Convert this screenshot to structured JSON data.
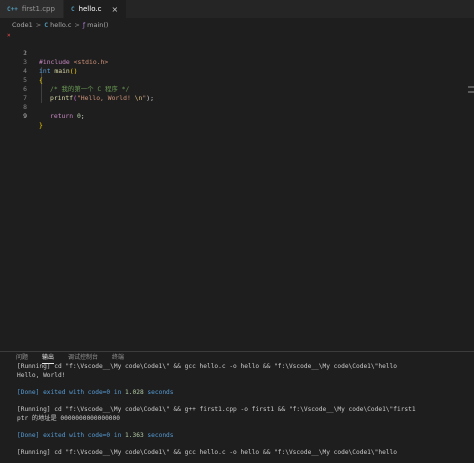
{
  "tabs": [
    {
      "lang": "C++",
      "label": "first1.cpp",
      "active": false
    },
    {
      "lang": "C",
      "label": "hello.c",
      "active": true,
      "close": "×"
    }
  ],
  "breadcrumb": {
    "folder": "Code1",
    "sep1": ">",
    "file_lang": "C",
    "file": "hello.c",
    "sep2": ">",
    "func_icon": "ƒ",
    "func": "main()"
  },
  "editor": {
    "line_numbers": [
      "1",
      "2",
      "3",
      "4",
      "5",
      "6",
      "7",
      "8",
      "9"
    ],
    "error_marker": "×",
    "lines": {
      "l1_inc": "#include",
      "l1_hdr": " <stdio.h>",
      "l3_type": "int",
      "l3_name": " main",
      "l3_parens": "()",
      "l4_brace": "{",
      "l5_comment": "/* 我的第一个 C 程序 */",
      "l6_fn": "printf",
      "l6_open": "(",
      "l6_str1": "\"Hello, World! ",
      "l6_esc": "\\n",
      "l6_str2": "\"",
      "l6_close": ");",
      "l8_kw": "return",
      "l8_num": " 0",
      "l8_semi": ";",
      "l9_brace": "}"
    }
  },
  "panel": {
    "tabs": [
      "问题",
      "输出",
      "调试控制台",
      "终端"
    ],
    "active_tab": "输出",
    "output": {
      "line1": "[Running] cd \"f:\\Vscode__\\My code\\Code1\\\" && gcc hello.c -o hello && \"f:\\Vscode__\\My code\\Code1\\\"hello",
      "line2": "Hello, World!",
      "line4_prefix": "[Done] exited with ",
      "line4_code": "code=0",
      "line4_mid": " in ",
      "line4_time": "1.028",
      "line4_suffix": " seconds",
      "line6": "[Running] cd \"f:\\Vscode__\\My code\\Code1\\\" && g++ first1.cpp -o first1 && \"f:\\Vscode__\\My code\\Code1\\\"first1",
      "line7": "ptr 的地址是 0000000000000000",
      "line9_prefix": "[Done] exited with ",
      "line9_code": "code=0",
      "line9_mid": " in ",
      "line9_time": "1.363",
      "line9_suffix": " seconds",
      "line11": "[Running] cd \"f:\\Vscode__\\My code\\Code1\\\" && gcc hello.c -o hello && \"f:\\Vscode__\\My code\\Code1\\\"hello"
    }
  },
  "colors": {
    "background": "#1e1e1e",
    "keyword": "#569cd6",
    "string": "#ce9178",
    "comment": "#6a9955",
    "function": "#dcdcaa",
    "error": "#f14c4c"
  }
}
